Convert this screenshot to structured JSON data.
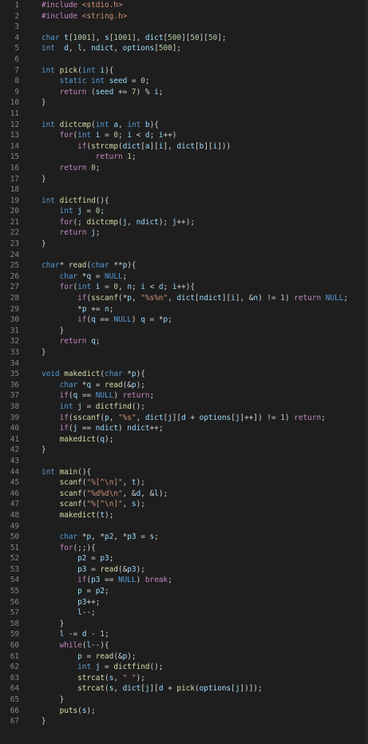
{
  "editor": {
    "language": "c",
    "colors": {
      "background": "#1e1e1e",
      "line_number": "#858585",
      "text": "#d4d4d4",
      "keyword": "#569cd6",
      "control": "#c586c0",
      "function": "#dcdcaa",
      "string": "#ce9178",
      "number": "#b5cea8",
      "variable": "#9cdcfe",
      "constant": "#4fc1ff",
      "preprocessor": "#c586c0"
    },
    "lines": [
      {
        "num": "1",
        "text": "#include <stdio.h>"
      },
      {
        "num": "2",
        "text": "#include <string.h>"
      },
      {
        "num": "3",
        "text": ""
      },
      {
        "num": "4",
        "text": "char t[1001], s[1001], dict[500][50][50];"
      },
      {
        "num": "5",
        "text": "int  d, l, ndict, options[500];"
      },
      {
        "num": "6",
        "text": ""
      },
      {
        "num": "7",
        "text": "int pick(int i){"
      },
      {
        "num": "8",
        "text": "    static int seed = 0;"
      },
      {
        "num": "9",
        "text": "    return (seed += 7) % i;"
      },
      {
        "num": "10",
        "text": "}"
      },
      {
        "num": "11",
        "text": ""
      },
      {
        "num": "12",
        "text": "int dictcmp(int a, int b){"
      },
      {
        "num": "13",
        "text": "    for(int i = 0; i < d; i++)"
      },
      {
        "num": "14",
        "text": "        if(strcmp(dict[a][i], dict[b][i]))"
      },
      {
        "num": "15",
        "text": "            return 1;"
      },
      {
        "num": "16",
        "text": "    return 0;"
      },
      {
        "num": "17",
        "text": "}"
      },
      {
        "num": "18",
        "text": ""
      },
      {
        "num": "19",
        "text": "int dictfind(){"
      },
      {
        "num": "20",
        "text": "    int j = 0;"
      },
      {
        "num": "21",
        "text": "    for(; dictcmp(j, ndict); j++);"
      },
      {
        "num": "22",
        "text": "    return j;"
      },
      {
        "num": "23",
        "text": "}"
      },
      {
        "num": "24",
        "text": ""
      },
      {
        "num": "25",
        "text": "char* read(char **p){"
      },
      {
        "num": "26",
        "text": "    char *q = NULL;"
      },
      {
        "num": "27",
        "text": "    for(int i = 0, n; i < d; i++){"
      },
      {
        "num": "28",
        "text": "        if(sscanf(*p, \"%s%n\", dict[ndict][i], &n) != 1) return NULL;"
      },
      {
        "num": "29",
        "text": "        *p += n;"
      },
      {
        "num": "30",
        "text": "        if(q == NULL) q = *p;"
      },
      {
        "num": "31",
        "text": "    }"
      },
      {
        "num": "32",
        "text": "    return q;"
      },
      {
        "num": "33",
        "text": "}"
      },
      {
        "num": "34",
        "text": ""
      },
      {
        "num": "35",
        "text": "void makedict(char *p){"
      },
      {
        "num": "36",
        "text": "    char *q = read(&p);"
      },
      {
        "num": "37",
        "text": "    if(q == NULL) return;"
      },
      {
        "num": "38",
        "text": "    int j = dictfind();"
      },
      {
        "num": "39",
        "text": "    if(sscanf(p, \"%s\", dict[j][d + options[j]++]) != 1) return;"
      },
      {
        "num": "40",
        "text": "    if(j == ndict) ndict++;"
      },
      {
        "num": "41",
        "text": "    makedict(q);"
      },
      {
        "num": "42",
        "text": "}"
      },
      {
        "num": "43",
        "text": ""
      },
      {
        "num": "44",
        "text": "int main(){"
      },
      {
        "num": "45",
        "text": "    scanf(\"%[^\\n]\", t);"
      },
      {
        "num": "46",
        "text": "    scanf(\"%d%d\\n\", &d, &l);"
      },
      {
        "num": "47",
        "text": "    scanf(\"%[^\\n]\", s);"
      },
      {
        "num": "48",
        "text": "    makedict(t);"
      },
      {
        "num": "49",
        "text": ""
      },
      {
        "num": "50",
        "text": "    char *p, *p2, *p3 = s;"
      },
      {
        "num": "51",
        "text": "    for(;;){"
      },
      {
        "num": "52",
        "text": "        p2 = p3;"
      },
      {
        "num": "53",
        "text": "        p3 = read(&p3);"
      },
      {
        "num": "54",
        "text": "        if(p3 == NULL) break;"
      },
      {
        "num": "55",
        "text": "        p = p2;"
      },
      {
        "num": "56",
        "text": "        p3++;"
      },
      {
        "num": "57",
        "text": "        l--;"
      },
      {
        "num": "58",
        "text": "    }"
      },
      {
        "num": "59",
        "text": "    l -= d - 1;"
      },
      {
        "num": "60",
        "text": "    while(l--){"
      },
      {
        "num": "61",
        "text": "        p = read(&p);"
      },
      {
        "num": "62",
        "text": "        int j = dictfind();"
      },
      {
        "num": "63",
        "text": "        strcat(s, \" \");"
      },
      {
        "num": "64",
        "text": "        strcat(s, dict[j][d + pick(options[j])]);"
      },
      {
        "num": "65",
        "text": "    }"
      },
      {
        "num": "66",
        "text": "    puts(s);"
      },
      {
        "num": "67",
        "text": "}"
      }
    ]
  }
}
